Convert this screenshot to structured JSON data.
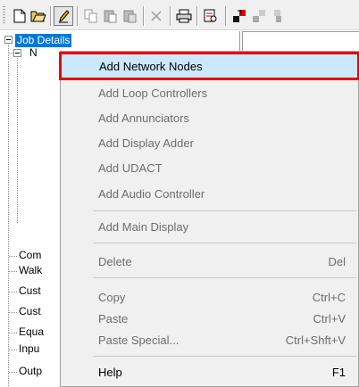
{
  "toolbar": {
    "buttons": [
      {
        "name": "new-icon"
      },
      {
        "name": "open-icon"
      },
      {
        "name": "edit-icon"
      },
      {
        "name": "copy-icon"
      },
      {
        "name": "paste-icon"
      },
      {
        "name": "paste-special-icon"
      },
      {
        "name": "delete-icon"
      },
      {
        "name": "print-icon"
      },
      {
        "name": "report-icon"
      },
      {
        "name": "download-icon"
      },
      {
        "name": "upload-icon"
      },
      {
        "name": "transfer-icon"
      }
    ]
  },
  "tree": {
    "root_label": "Job Details",
    "child_label": "N",
    "leaf_items": [
      "Com",
      "Walk",
      "Cust",
      "Cust",
      "Equa",
      "Inpu",
      "Outp"
    ]
  },
  "menu": {
    "items": [
      {
        "label": "Add Network Nodes",
        "shortcut": "",
        "enabled": true,
        "highlighted": true
      },
      {
        "label": "Add Loop Controllers",
        "shortcut": "",
        "enabled": false
      },
      {
        "label": "Add Annunciators",
        "shortcut": "",
        "enabled": false
      },
      {
        "label": "Add Display Adder",
        "shortcut": "",
        "enabled": false
      },
      {
        "label": "Add UDACT",
        "shortcut": "",
        "enabled": false
      },
      {
        "label": "Add Audio Controller",
        "shortcut": "",
        "enabled": false
      },
      {
        "label": "Add Main Display",
        "shortcut": "",
        "enabled": false
      },
      {
        "label": "Delete",
        "shortcut": "Del",
        "enabled": false
      },
      {
        "label": "Copy",
        "shortcut": "Ctrl+C",
        "enabled": false
      },
      {
        "label": "Paste",
        "shortcut": "Ctrl+V",
        "enabled": false
      },
      {
        "label": "Paste Special...",
        "shortcut": "Ctrl+Shft+V",
        "enabled": false
      },
      {
        "label": "Help",
        "shortcut": "F1",
        "enabled": true
      }
    ]
  },
  "colors": {
    "selection": "#0078d7",
    "highlight_bg": "#cce8ff",
    "highlight_border": "#e8000b",
    "disabled_text": "#6d6d6d"
  }
}
